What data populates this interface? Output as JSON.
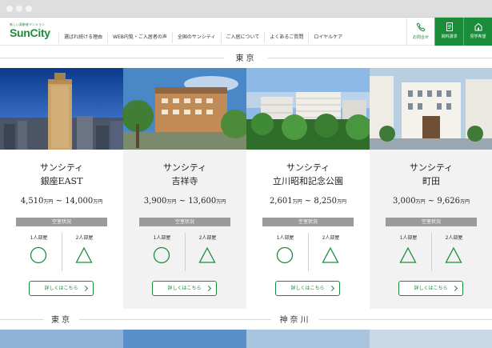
{
  "header": {
    "logo_tagline": "新しい高齢者マンション",
    "logo": "SunCity",
    "nav": [
      {
        "label": "選ばれ続ける理由"
      },
      {
        "label": "WEB内覧・ご入居者の声"
      },
      {
        "label": "全国のサンシティ"
      },
      {
        "label": "ご入居について"
      },
      {
        "label": "よくあるご質問"
      },
      {
        "label": "ロイヤルケア"
      }
    ],
    "contact": {
      "label": "お問合せ",
      "icon": "phone-icon"
    },
    "buttons": [
      {
        "label": "資料請求",
        "icon": "document-icon"
      },
      {
        "label": "見学希望",
        "icon": "house-icon"
      }
    ]
  },
  "sections": {
    "tokyo": "東京",
    "tokyo2": "東京",
    "kanagawa": "神奈川"
  },
  "colors": {
    "brand_green": "#1b8d3a",
    "vacancy_gray": "#9b9b9b"
  },
  "vacancy_label": "空室状況",
  "room_labels": [
    "1人部屋",
    "2人部屋"
  ],
  "more_label": "詳しくはこちら",
  "properties": [
    {
      "brand": "サンシティ",
      "name": "銀座EAST",
      "price_min": "4,510",
      "price_max": "14,000",
      "unit": "万円",
      "single": "○",
      "double": "△"
    },
    {
      "brand": "サンシティ",
      "name": "吉祥寺",
      "price_min": "3,900",
      "price_max": "13,600",
      "unit": "万円",
      "single": "○",
      "double": "△"
    },
    {
      "brand": "サンシティ",
      "name": "立川昭和記念公園",
      "price_min": "2,601",
      "price_max": "8,250",
      "unit": "万円",
      "single": "○",
      "double": "△"
    },
    {
      "brand": "サンシティ",
      "name": "町田",
      "price_min": "3,000",
      "price_max": "9,626",
      "unit": "万円",
      "single": "△",
      "double": "△"
    }
  ]
}
